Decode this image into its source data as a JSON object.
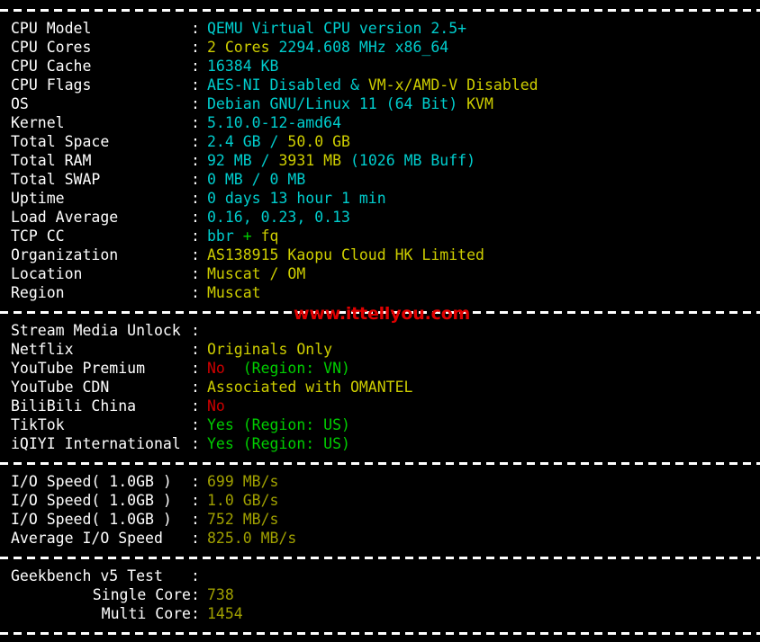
{
  "terminal": {
    "title": "VPS Benchmark Output",
    "watermark": "www.ittellyou.com",
    "colon": ":",
    "colors": {
      "background": "#000000",
      "label": "#ffffff",
      "cyan": "#00cdcd",
      "yellow": "#cdcd00",
      "olive": "#a0a000",
      "green": "#00cd00",
      "red": "#cd0000",
      "watermark": "#e00000"
    }
  },
  "system_info": {
    "rows": [
      {
        "label": "CPU Model",
        "value": "QEMU Virtual CPU version 2.5+"
      },
      {
        "label": "CPU Cores",
        "value": "2 Cores 2294.608 MHz x86_64",
        "parts": [
          {
            "t": "2 Cores ",
            "c": "y"
          },
          {
            "t": "2294.608 MHz x86_64",
            "c": "c"
          }
        ]
      },
      {
        "label": "CPU Cache",
        "value": "16384 KB"
      },
      {
        "label": "CPU Flags",
        "value": "AES-NI Disabled & VM-x/AMD-V Disabled",
        "parts": [
          {
            "t": "AES-NI Disabled & ",
            "c": "c"
          },
          {
            "t": "VM-x/AMD-V Disabled",
            "c": "y"
          }
        ]
      },
      {
        "label": "OS",
        "value": "Debian GNU/Linux 11 (64 Bit) KVM",
        "parts": [
          {
            "t": "Debian GNU/Linux 11 (64 Bit) ",
            "c": "c"
          },
          {
            "t": "KVM",
            "c": "y"
          }
        ]
      },
      {
        "label": "Kernel",
        "value": "5.10.0-12-amd64"
      },
      {
        "label": "Total Space",
        "value": "2.4 GB / 50.0 GB",
        "parts": [
          {
            "t": "2.4 GB / ",
            "c": "c"
          },
          {
            "t": "50.0 GB",
            "c": "y"
          }
        ]
      },
      {
        "label": "Total RAM",
        "value": "92 MB / 3931 MB (1026 MB Buff)",
        "parts": [
          {
            "t": "92 MB / ",
            "c": "c"
          },
          {
            "t": "3931 MB",
            "c": "y"
          },
          {
            "t": " (1026 MB Buff)",
            "c": "c"
          }
        ]
      },
      {
        "label": "Total SWAP",
        "value": "0 MB / 0 MB"
      },
      {
        "label": "Uptime",
        "value": "0 days 13 hour 1 min"
      },
      {
        "label": "Load Average",
        "value": "0.16, 0.23, 0.13"
      },
      {
        "label": "TCP CC",
        "value": "bbr + fq",
        "parts": [
          {
            "t": "bbr ",
            "c": "c"
          },
          {
            "t": "+",
            "c": "g"
          },
          {
            "t": " fq",
            "c": "y"
          }
        ]
      },
      {
        "label": "Organization",
        "value": "AS138915 Kaopu Cloud HK Limited",
        "color": "y"
      },
      {
        "label": "Location",
        "value": "Muscat / OM",
        "color": "y"
      },
      {
        "label": "Region",
        "value": "Muscat",
        "color": "y"
      }
    ]
  },
  "stream_media": {
    "rows": [
      {
        "label": "Stream Media Unlock",
        "value": ""
      },
      {
        "label": "Netflix",
        "value": "Originals Only",
        "color": "y"
      },
      {
        "label": "YouTube Premium",
        "value": "No  (Region: VN)",
        "parts": [
          {
            "t": "No ",
            "c": "r"
          },
          {
            "t": " (Region: VN)",
            "c": "g"
          }
        ]
      },
      {
        "label": "YouTube CDN",
        "value": "Associated with OMANTEL",
        "color": "y"
      },
      {
        "label": "BiliBili China",
        "value": "No",
        "color": "r"
      },
      {
        "label": "TikTok",
        "value": "Yes (Region: US)",
        "color": "g"
      },
      {
        "label": "iQIYI International",
        "value": "Yes (Region: US)",
        "color": "g"
      }
    ]
  },
  "io_speed": {
    "rows": [
      {
        "label": "I/O Speed( 1.0GB )",
        "value": "699 MB/s",
        "color": "ol"
      },
      {
        "label": "I/O Speed( 1.0GB )",
        "value": "1.0 GB/s",
        "color": "ol"
      },
      {
        "label": "I/O Speed( 1.0GB )",
        "value": "752 MB/s",
        "color": "ol"
      },
      {
        "label": "Average I/O Speed",
        "value": "825.0 MB/s",
        "color": "ol"
      }
    ]
  },
  "geekbench": {
    "rows": [
      {
        "label": "Geekbench v5 Test",
        "value": "",
        "indent": false
      },
      {
        "label": "Single Core",
        "value": "738",
        "color": "ol",
        "indent": true
      },
      {
        "label": "Multi Core",
        "value": "1454",
        "color": "ol",
        "indent": true
      }
    ]
  }
}
